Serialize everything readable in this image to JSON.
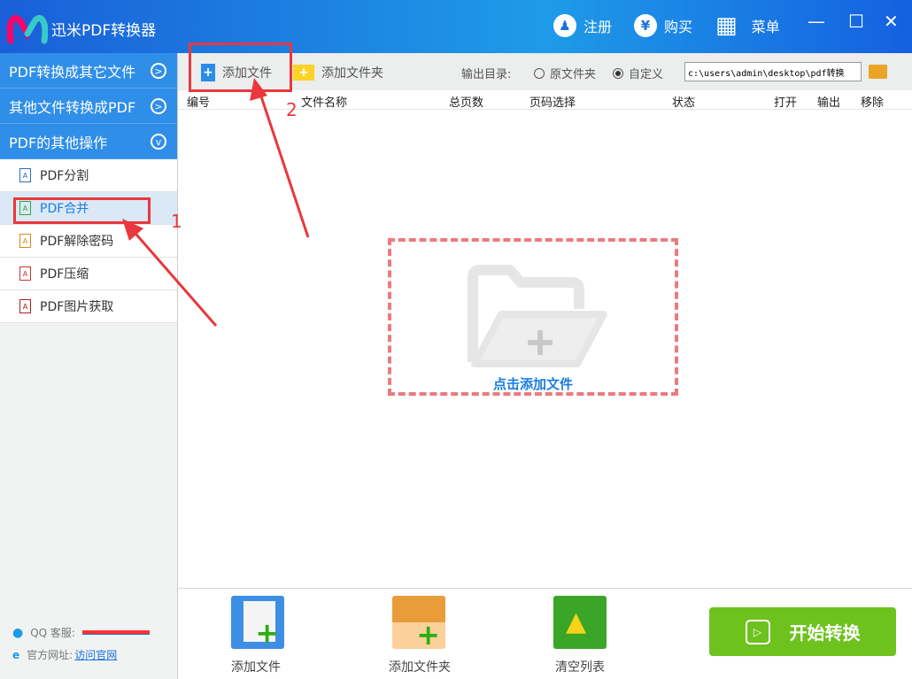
{
  "app": {
    "title": "迅米PDF转换器",
    "register": "注册",
    "buy": "购买",
    "menu": "菜单"
  },
  "sidebar": {
    "sections": [
      {
        "label": "PDF转换成其它文件"
      },
      {
        "label": "其他文件转换成PDF"
      },
      {
        "label": "PDF的其他操作"
      }
    ],
    "items": [
      {
        "label": "PDF分割"
      },
      {
        "label": "PDF合并"
      },
      {
        "label": "PDF解除密码"
      },
      {
        "label": "PDF压缩"
      },
      {
        "label": "PDF图片获取"
      }
    ],
    "qq_label": "QQ 客服:",
    "site_label": "官方网址:",
    "site_link": "访问官网"
  },
  "toolbar": {
    "add_file": "添加文件",
    "add_folder": "添加文件夹",
    "output_label": "输出目录:",
    "opt_original": "原文件夹",
    "opt_custom": "自定义",
    "selected": "自定义",
    "output_path": "c:\\users\\admin\\desktop\\pdf转换"
  },
  "table": {
    "columns": [
      "编号",
      "文件名称",
      "总页数",
      "页码选择",
      "状态",
      "打开",
      "输出",
      "移除"
    ]
  },
  "dropzone": {
    "label": "点击添加文件"
  },
  "bottom": {
    "add_file": "添加文件",
    "add_folder": "添加文件夹",
    "clear": "清空列表",
    "start": "开始转换"
  },
  "annotations": {
    "one": "1",
    "two": "2"
  },
  "colors": {
    "accent": "#2f8ee8",
    "start": "#6dc21e",
    "annotation": "#e8383d"
  }
}
